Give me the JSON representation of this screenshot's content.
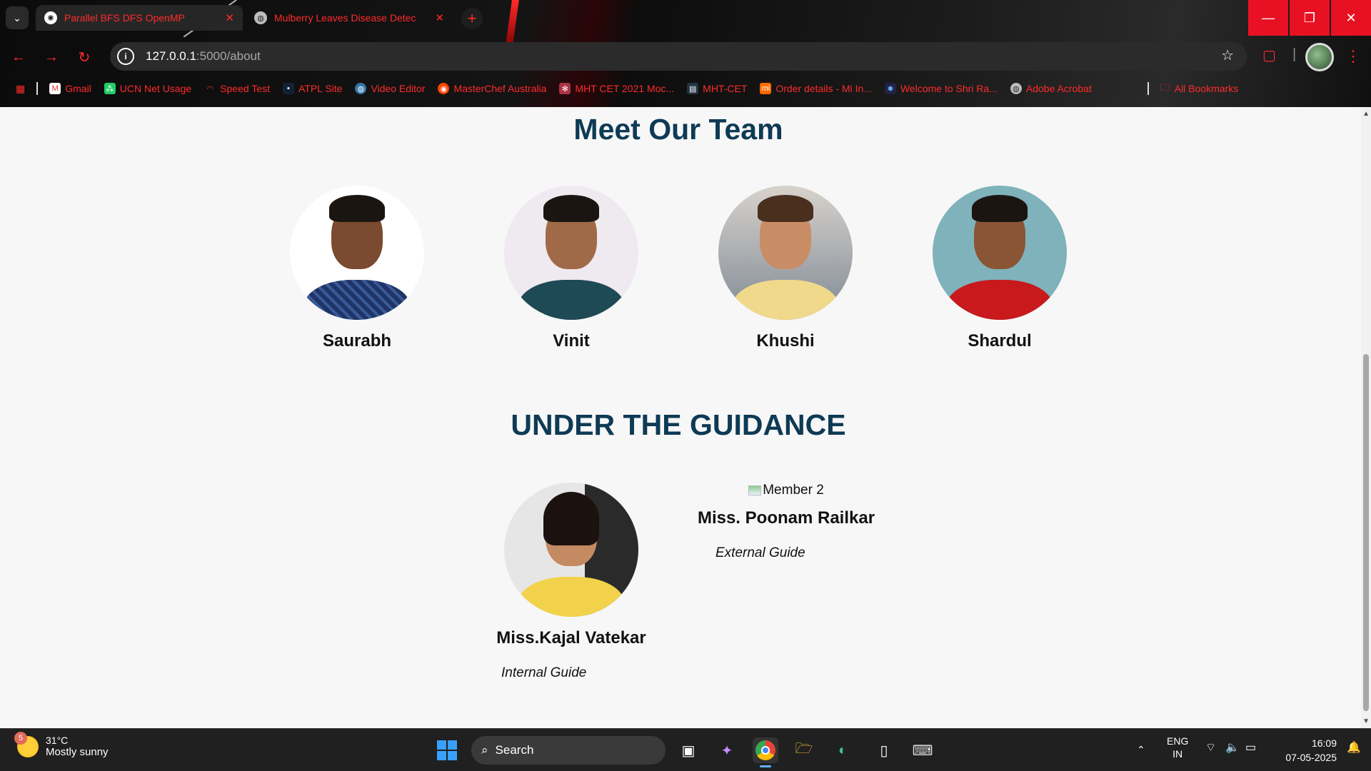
{
  "browser": {
    "tabs": [
      {
        "title": "Parallel BFS DFS OpenMP",
        "active": true
      },
      {
        "title": "Mulberry Leaves Disease Detec",
        "active": false
      }
    ],
    "url_host": "127.0.0.1",
    "url_path": ":5000/about",
    "bookmarks": [
      {
        "label": "Gmail",
        "icon": "gmail-icon"
      },
      {
        "label": "UCN Net Usage",
        "icon": "network-icon"
      },
      {
        "label": "Speed Test",
        "icon": "gauge-icon"
      },
      {
        "label": "ATPL Site",
        "icon": "site-icon"
      },
      {
        "label": "Video Editor",
        "icon": "globe-icon"
      },
      {
        "label": "MasterChef Australia",
        "icon": "reddit-icon"
      },
      {
        "label": "MHT CET 2021 Moc...",
        "icon": "grid-icon"
      },
      {
        "label": "MHT-CET",
        "icon": "doc-icon"
      },
      {
        "label": "Order details - Mi In...",
        "icon": "mi-icon"
      },
      {
        "label": "Welcome to Shri Ra...",
        "icon": "emblem-icon"
      },
      {
        "label": "Adobe Acrobat",
        "icon": "globe-icon"
      }
    ],
    "all_bookmarks": "All Bookmarks",
    "accent_color": "#ff2a2a"
  },
  "page": {
    "team_heading": "Meet Our Team",
    "team": [
      {
        "name": "Saurabh"
      },
      {
        "name": "Vinit"
      },
      {
        "name": "Khushi"
      },
      {
        "name": "Shardul"
      }
    ],
    "guidance_heading": "UNDER THE GUIDANCE",
    "guides": [
      {
        "name": "Miss.Kajal Vatekar",
        "role": "Internal Guide"
      },
      {
        "name": "Miss. Poonam Railkar",
        "role": "External Guide",
        "broken_image_alt": "Member 2"
      }
    ],
    "heading_color": "#0e3a55"
  },
  "taskbar": {
    "weather_temp": "31°C",
    "weather_desc": "Mostly sunny",
    "weather_badge": "5",
    "search_label": "Search",
    "lang_1": "ENG",
    "lang_2": "IN",
    "time": "16:09",
    "date": "07-05-2025"
  }
}
